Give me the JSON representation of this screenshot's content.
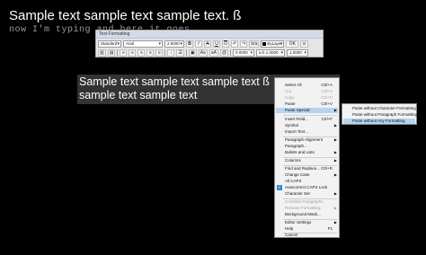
{
  "heading": "Sample text sample text sample text.  ß",
  "typing_line": "now I'm typing and here it goes...",
  "toolbar": {
    "title": "Text Formatting",
    "style": "Standard",
    "font": "Arial",
    "height": "2.5000",
    "bold": "B",
    "italic": "I",
    "strike": "A",
    "underline": "U",
    "overline": "O",
    "undo": "↶",
    "redo": "↷",
    "stack": "b/a",
    "color": "ByLayer",
    "ok": "OK",
    "oblique": "0.0000",
    "tracking": "a-b 1.0000",
    "width": "1.0000"
  },
  "editor": {
    "line1": "Sample text sample text sample text ß",
    "line2": "sample text sample text"
  },
  "context_menu": {
    "items": [
      {
        "label": "Select All",
        "shortcut": "Ctrl+A",
        "disabled": false
      },
      {
        "label": "Cut",
        "shortcut": "Ctrl+X",
        "disabled": true
      },
      {
        "label": "Copy",
        "shortcut": "Ctrl+C",
        "disabled": true
      },
      {
        "label": "Paste",
        "shortcut": "Ctrl+V",
        "disabled": false
      },
      {
        "label": "Paste Special",
        "shortcut": "",
        "disabled": false,
        "submenu": true,
        "highlighted": true
      },
      {
        "label": "Insert Field...",
        "shortcut": "Ctrl+F",
        "disabled": false
      },
      {
        "label": "Symbol",
        "shortcut": "",
        "disabled": false,
        "submenu": true
      },
      {
        "label": "Import Text...",
        "shortcut": "",
        "disabled": false
      },
      {
        "label": "Paragraph Alignment",
        "shortcut": "",
        "disabled": false,
        "submenu": true
      },
      {
        "label": "Paragraph...",
        "shortcut": "",
        "disabled": false
      },
      {
        "label": "Bullets and Lists",
        "shortcut": "",
        "disabled": false,
        "submenu": true
      },
      {
        "label": "Columns",
        "shortcut": "",
        "disabled": false,
        "submenu": true
      },
      {
        "label": "Find and Replace...",
        "shortcut": "Ctrl+R",
        "disabled": false
      },
      {
        "label": "Change Case",
        "shortcut": "",
        "disabled": false,
        "submenu": true
      },
      {
        "label": "All CAPS",
        "shortcut": "",
        "disabled": false
      },
      {
        "label": "Autocorrect CAPS Lock",
        "shortcut": "",
        "disabled": false,
        "checked": true
      },
      {
        "label": "Character Set",
        "shortcut": "",
        "disabled": false,
        "submenu": true
      },
      {
        "label": "Combine Paragraphs",
        "shortcut": "",
        "disabled": true
      },
      {
        "label": "Remove Formatting",
        "shortcut": "",
        "disabled": true,
        "submenu": true
      },
      {
        "label": "Background Mask...",
        "shortcut": "",
        "disabled": false
      },
      {
        "label": "Editor Settings",
        "shortcut": "",
        "disabled": false,
        "submenu": true
      },
      {
        "label": "Help",
        "shortcut": "F1",
        "disabled": false
      },
      {
        "label": "Cancel",
        "shortcut": "",
        "disabled": false
      }
    ]
  },
  "submenu": {
    "items": [
      {
        "label": "Paste without Character Formatting",
        "highlighted": false
      },
      {
        "label": "Paste without Paragraph Formatting",
        "highlighted": false
      },
      {
        "label": "Paste without Any Formatting",
        "highlighted": true
      }
    ]
  }
}
